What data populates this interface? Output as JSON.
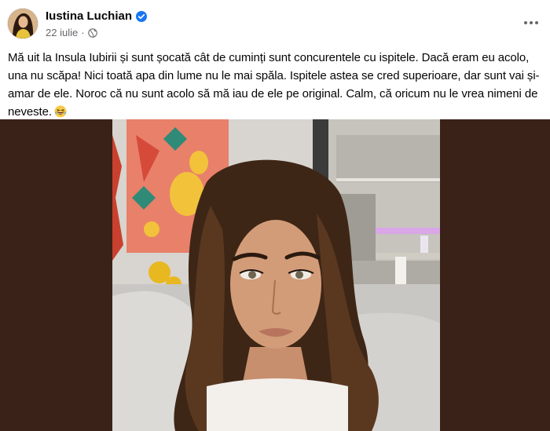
{
  "post": {
    "author": {
      "name": "Iustina Luchian",
      "verified": true,
      "avatar_icon": "profile-avatar"
    },
    "meta": {
      "date": "22 iulie",
      "separator": "·",
      "audience_icon": "globe-icon"
    },
    "more_icon": "more-horizontal-icon",
    "caption": "Mă uit la Insula Iubirii și sunt șocată cât de cuminți sunt concurentele cu ispitele. Dacă eram eu acolo, una nu scăpa! Nici toată apa din lume nu le mai spăla. Ispitele astea se cred superioare, dar sunt vai și-amar de ele. Noroc că nu sunt acolo să mă iau de ele pe original. Calm, că oricum nu le vrea nimeni de neveste.",
    "caption_emoji": "laughing-with-tears-emoji",
    "media": {
      "type": "photo",
      "background_color": "#3a2218"
    }
  },
  "colors": {
    "text_primary": "#050505",
    "text_secondary": "#65676b",
    "verified_blue": "#1877f2"
  }
}
